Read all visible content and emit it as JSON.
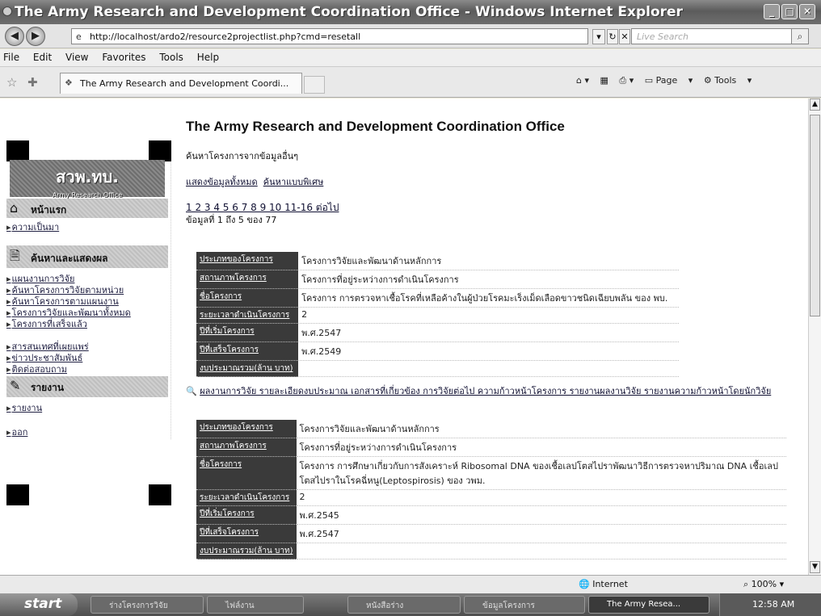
{
  "window": {
    "title": "The Army Research and Development Coordination Office - Windows Internet Explorer"
  },
  "address": {
    "url": "http://localhost/ardo2/resource2projectlist.php?cmd=resetall",
    "search_placeholder": "Live Search"
  },
  "menu": [
    "File",
    "Edit",
    "View",
    "Favorites",
    "Tools",
    "Help"
  ],
  "tab": {
    "label": "The Army Research and Development Coordi..."
  },
  "commands": {
    "page": "Page",
    "tools": "Tools"
  },
  "sidebar": {
    "logo": "สวพ.ทบ.",
    "logo_sub": "Army Research Office",
    "home": "หน้าแรก",
    "home_link": "ความเป็นมา",
    "search_section": "ค้นหาและแสดงผล",
    "search_links": [
      "แผนงานการวิจัย",
      "ค้นหาโครงการวิจัยตามหน่วย",
      "ค้นหาโครงการตามแผนงาน",
      "โครงการวิจัยและพัฒนาทั้งหมด",
      "โครงการที่เสร็จแล้ว"
    ],
    "other_links": [
      "สารสนเทศที่เผยแพร่",
      "ข่าวประชาสัมพันธ์",
      "ติดต่อสอบถาม"
    ],
    "report_section": "รายงาน",
    "report_link": "รายงาน",
    "logout": "ออก"
  },
  "main": {
    "title": "The Army Research and Development Coordination Office",
    "search_caption": "ค้นหาโครงการจากข้อมูลอื่นๆ",
    "show_all": "แสดงข้อมูลทั้งหมด",
    "advanced": "ค้นหาแบบพิเศษ",
    "pages": "1 2 3 4 5 6 7 8 9 10 11-16 ต่อไป",
    "records": "ข้อมูลที่ 1 ถึง 5 ของ 77",
    "record1": [
      {
        "k": "ประเภทของโครงการ",
        "v": "โครงการวิจัยและพัฒนาด้านหลักการ"
      },
      {
        "k": "สถานภาพโครงการ",
        "v": "โครงการที่อยู่ระหว่างการดำเนินโครงการ"
      },
      {
        "k": "ชื่อโครงการ",
        "v": "โครงการ การตรวจหาเชื้อโรคที่เหลือค้างในผู้ป่วยโรคมะเร็งเม็ดเลือดขาวชนิดเฉียบพลัน ของ พบ."
      },
      {
        "k": "ระยะเวลาดำเนินโครงการ",
        "v": "2"
      },
      {
        "k": "ปีที่เริ่มโครงการ",
        "v": "พ.ศ.2547"
      },
      {
        "k": "ปีที่เสร็จโครงการ",
        "v": "พ.ศ.2549"
      },
      {
        "k": "งบประมาณรวม(ล้าน บาท)",
        "v": ""
      }
    ],
    "actions": "ผลงานการวิจัย  รายละเอียดงบประมาณ  เอกสารที่เกี่ยวข้อง  การวิจัยต่อไป  ความก้าวหน้าโครงการ  รายงานผลงานวิจัย  รายงานความก้าวหน้าโดยนักวิจัย",
    "record2": [
      {
        "k": "ประเภทของโครงการ",
        "v": "โครงการวิจัยและพัฒนาด้านหลักการ"
      },
      {
        "k": "สถานภาพโครงการ",
        "v": "โครงการที่อยู่ระหว่างการดำเนินโครงการ"
      },
      {
        "k": "ชื่อโครงการ",
        "v": "โครงการ การศึกษาเกี่ยวกับการสังเคราะห์ Ribosomal DNA ของเชื้อเลปโตสไปราพัฒนาวิธีการตรวจหาปริมาณ DNA เชื้อเลปโตสไปราในโรคฉี่หนู(Leptospirosis) ของ วพม."
      },
      {
        "k": "ระยะเวลาดำเนินโครงการ",
        "v": "2"
      },
      {
        "k": "ปีที่เริ่มโครงการ",
        "v": "พ.ศ.2545"
      },
      {
        "k": "ปีที่เสร็จโครงการ",
        "v": "พ.ศ.2547"
      },
      {
        "k": "งบประมาณรวม(ล้าน บาท)",
        "v": ""
      }
    ]
  },
  "status": {
    "zone": "Internet",
    "zoom": "100%"
  },
  "taskbar": {
    "start": "start",
    "items": [
      "ร่างโครงการวิจัย",
      "ไฟล์งาน",
      "หนังสือร่าง",
      "ข้อมูลโครงการ",
      "The Army Resea..."
    ],
    "clock": "12:58 AM"
  }
}
